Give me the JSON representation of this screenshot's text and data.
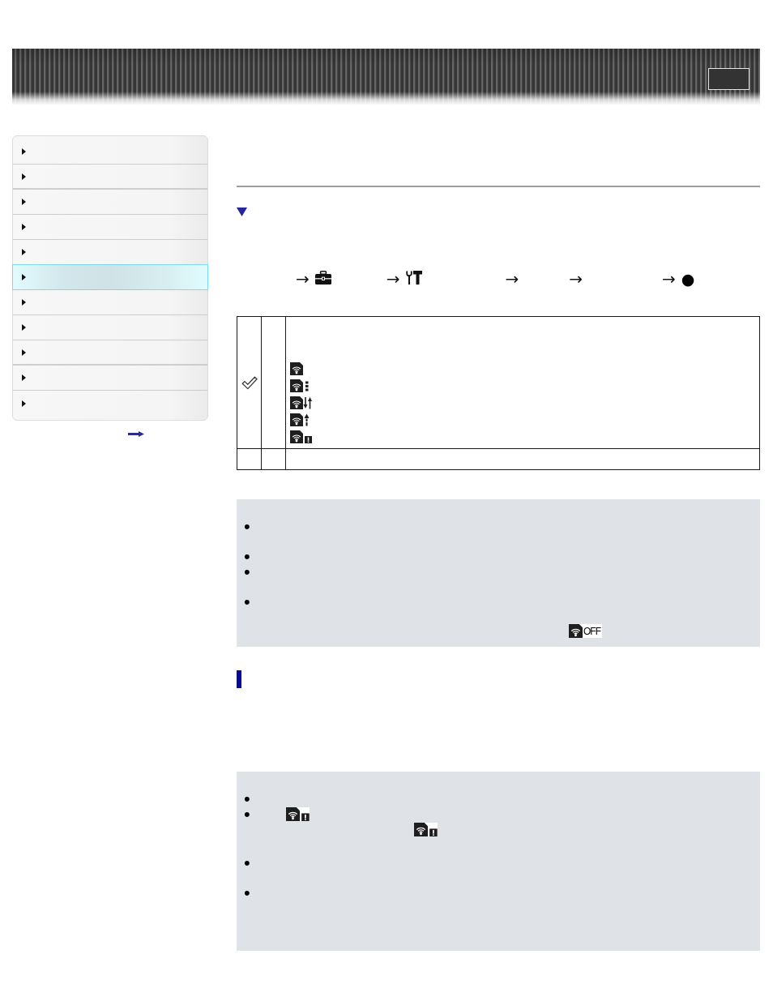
{
  "sidebar": {
    "items": [
      {
        "selected": false
      },
      {
        "selected": false
      },
      {
        "selected": false
      },
      {
        "selected": false
      },
      {
        "selected": false
      },
      {
        "selected": true
      },
      {
        "selected": false
      },
      {
        "selected": false
      },
      {
        "selected": false
      },
      {
        "selected": false
      },
      {
        "selected": false
      }
    ]
  },
  "menu_path": [
    {
      "kind": "toolbox",
      "arrow": "→"
    },
    {
      "kind": "tools",
      "arrow": "→"
    },
    {
      "kind": "plain",
      "arrow": "→"
    },
    {
      "kind": "plain",
      "arrow": "→"
    },
    {
      "kind": "symbol",
      "arrow": "→",
      "symbol": "●"
    }
  ],
  "table": {
    "rows": [
      {
        "checked": true,
        "status_icons": [
          {
            "kind": "plain"
          },
          {
            "kind": "dots"
          },
          {
            "kind": "arrows"
          },
          {
            "kind": "up-arrow"
          },
          {
            "kind": "warning"
          }
        ]
      },
      {
        "checked": false
      }
    ]
  },
  "notes": {
    "items": [
      {
        "bullet": "•"
      },
      {
        "bullet": "•"
      },
      {
        "bullet": "•"
      },
      {
        "bullet": "•",
        "icons": [
          {
            "kind": "off",
            "label": "OFF"
          }
        ]
      }
    ]
  },
  "section_2": {
    "notes": {
      "items": [
        {
          "bullet": "•"
        },
        {
          "bullet": "•",
          "icons": [
            {
              "kind": "warning"
            },
            {
              "kind": "warning"
            }
          ]
        },
        {
          "bullet": "•"
        },
        {
          "bullet": "•"
        }
      ]
    }
  }
}
